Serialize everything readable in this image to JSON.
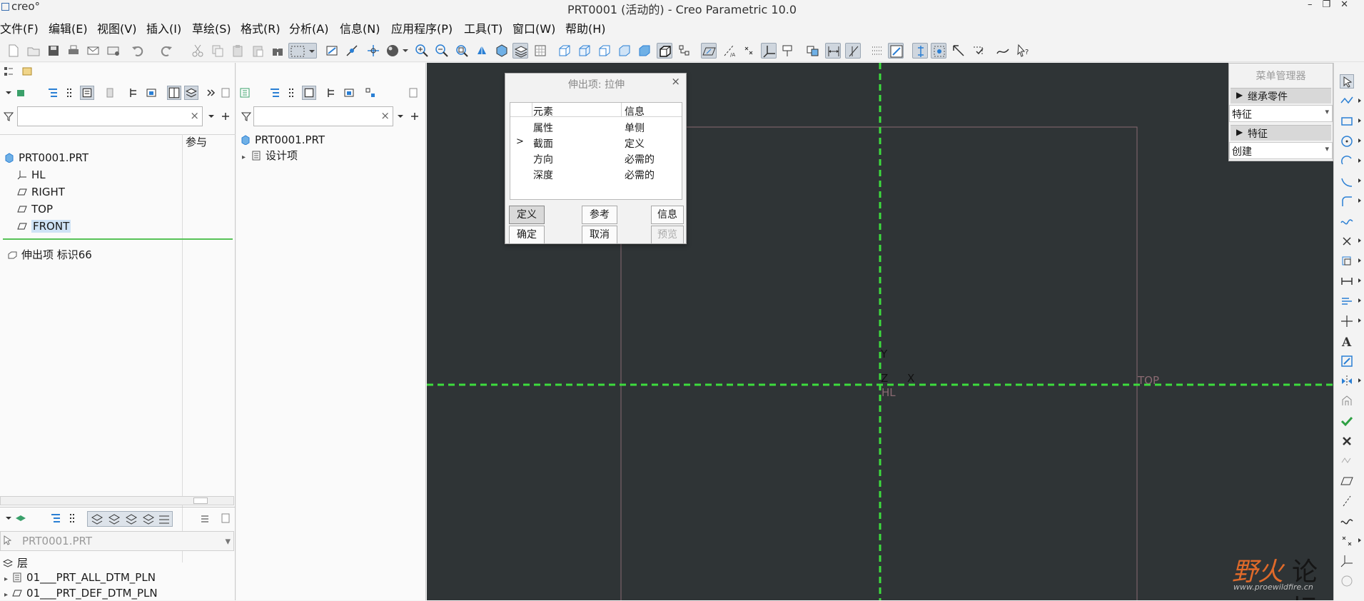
{
  "window": {
    "logo_text": "creo°",
    "title": "PRT0001 (活动的) - Creo Parametric 10.0",
    "controls": [
      "–",
      "❐",
      "✕"
    ]
  },
  "menu": [
    "文件(F)",
    "编辑(E)",
    "视图(V)",
    "插入(I)",
    "草绘(S)",
    "格式(R)",
    "分析(A)",
    "信息(N)",
    "应用程序(P)",
    "工具(T)",
    "窗口(W)",
    "帮助(H)"
  ],
  "model_tree": {
    "column_header": "参与",
    "root": "PRT0001.PRT",
    "items": [
      "HL",
      "RIGHT",
      "TOP",
      "FRONT"
    ],
    "insert_item": "伸出项 标识66"
  },
  "layer_panel": {
    "model_select": "PRT0001.PRT",
    "header": "层",
    "items": [
      "01___PRT_ALL_DTM_PLN",
      "01___PRT_DEF_DTM_PLN"
    ]
  },
  "detail_tree": {
    "root": "PRT0001.PRT",
    "items": [
      "设计项"
    ]
  },
  "dialog": {
    "title": "伸出项: 拉伸",
    "headers": [
      "元素",
      "信息"
    ],
    "rows": [
      {
        "marker": "",
        "element": "属性",
        "info": "单侧"
      },
      {
        "marker": ">",
        "element": "截面",
        "info": "定义"
      },
      {
        "marker": "",
        "element": "方向",
        "info": "必需的"
      },
      {
        "marker": "",
        "element": "深度",
        "info": "必需的"
      }
    ],
    "buttons": {
      "define": "定义",
      "refs": "参考",
      "info": "信息",
      "ok": "确定",
      "cancel": "取消",
      "preview": "预览"
    }
  },
  "menu_manager": {
    "title": "菜单管理器",
    "section1": "继承零件",
    "select1": "特征",
    "section2": "特征",
    "select2": "创建"
  },
  "canvas": {
    "labels": {
      "y": "Y",
      "z": "Z",
      "x": "X",
      "hl": "HL",
      "top": "TOP"
    }
  },
  "watermark": {
    "chars_red": "野火",
    "chars_dark": "论坛",
    "url": "www.proewildfire.cn"
  },
  "colors": {
    "canvas_bg": "#2f3436",
    "datum_green": "#3ddc3d",
    "plane_outline": "#8a6a72",
    "selection_bg": "#cfe3f6",
    "accent_blue": "#2a7fd4"
  }
}
